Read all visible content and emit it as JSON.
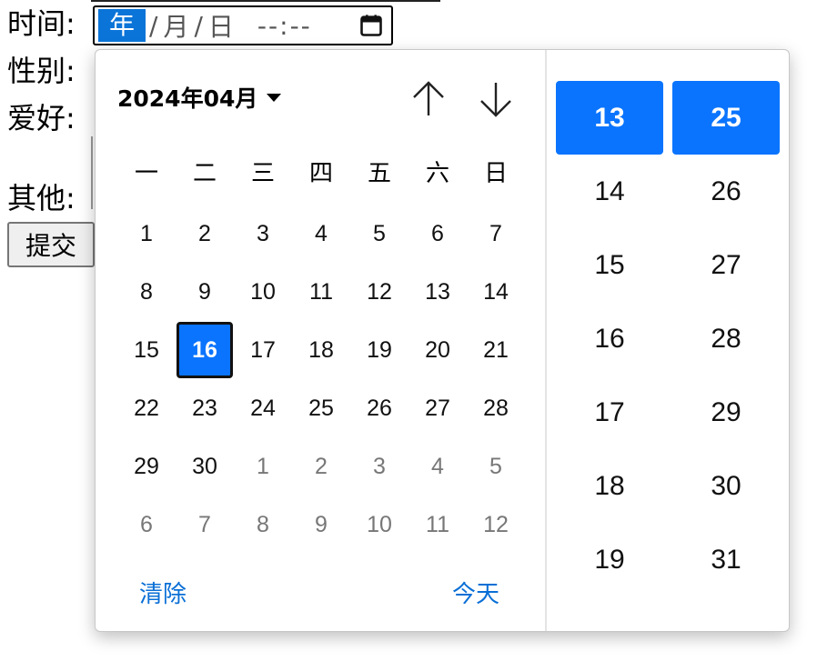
{
  "form": {
    "labels": {
      "time": "时间:",
      "gender": "性别:",
      "hobby": "爱好:",
      "other": "其他:"
    },
    "submit_label": "提交"
  },
  "datetime_input": {
    "year_placeholder": "年",
    "month_placeholder": "月",
    "day_placeholder": "日",
    "separator": "/",
    "time_placeholder": "--:--",
    "icon": "calendar-icon"
  },
  "picker": {
    "month_title": "2024年04月",
    "weekdays": [
      "一",
      "二",
      "三",
      "四",
      "五",
      "六",
      "日"
    ],
    "days": [
      {
        "label": "1",
        "other": false
      },
      {
        "label": "2",
        "other": false
      },
      {
        "label": "3",
        "other": false
      },
      {
        "label": "4",
        "other": false
      },
      {
        "label": "5",
        "other": false
      },
      {
        "label": "6",
        "other": false
      },
      {
        "label": "7",
        "other": false
      },
      {
        "label": "8",
        "other": false
      },
      {
        "label": "9",
        "other": false
      },
      {
        "label": "10",
        "other": false
      },
      {
        "label": "11",
        "other": false
      },
      {
        "label": "12",
        "other": false
      },
      {
        "label": "13",
        "other": false
      },
      {
        "label": "14",
        "other": false
      },
      {
        "label": "15",
        "other": false
      },
      {
        "label": "16",
        "other": false,
        "selected": true
      },
      {
        "label": "17",
        "other": false
      },
      {
        "label": "18",
        "other": false
      },
      {
        "label": "19",
        "other": false
      },
      {
        "label": "20",
        "other": false
      },
      {
        "label": "21",
        "other": false
      },
      {
        "label": "22",
        "other": false
      },
      {
        "label": "23",
        "other": false
      },
      {
        "label": "24",
        "other": false
      },
      {
        "label": "25",
        "other": false
      },
      {
        "label": "26",
        "other": false
      },
      {
        "label": "27",
        "other": false
      },
      {
        "label": "28",
        "other": false
      },
      {
        "label": "29",
        "other": false
      },
      {
        "label": "30",
        "other": false
      },
      {
        "label": "1",
        "other": true
      },
      {
        "label": "2",
        "other": true
      },
      {
        "label": "3",
        "other": true
      },
      {
        "label": "4",
        "other": true
      },
      {
        "label": "5",
        "other": true
      },
      {
        "label": "6",
        "other": true
      },
      {
        "label": "7",
        "other": true
      },
      {
        "label": "8",
        "other": true
      },
      {
        "label": "9",
        "other": true
      },
      {
        "label": "10",
        "other": true
      },
      {
        "label": "11",
        "other": true
      },
      {
        "label": "12",
        "other": true
      }
    ],
    "clear_label": "清除",
    "today_label": "今天",
    "hours": [
      "13",
      "14",
      "15",
      "16",
      "17",
      "18",
      "19"
    ],
    "minutes": [
      "25",
      "26",
      "27",
      "28",
      "29",
      "30",
      "31"
    ],
    "selected_hour": "13",
    "selected_minute": "25",
    "accent_color": "#0a74ff",
    "link_color": "#0a6fd6"
  }
}
